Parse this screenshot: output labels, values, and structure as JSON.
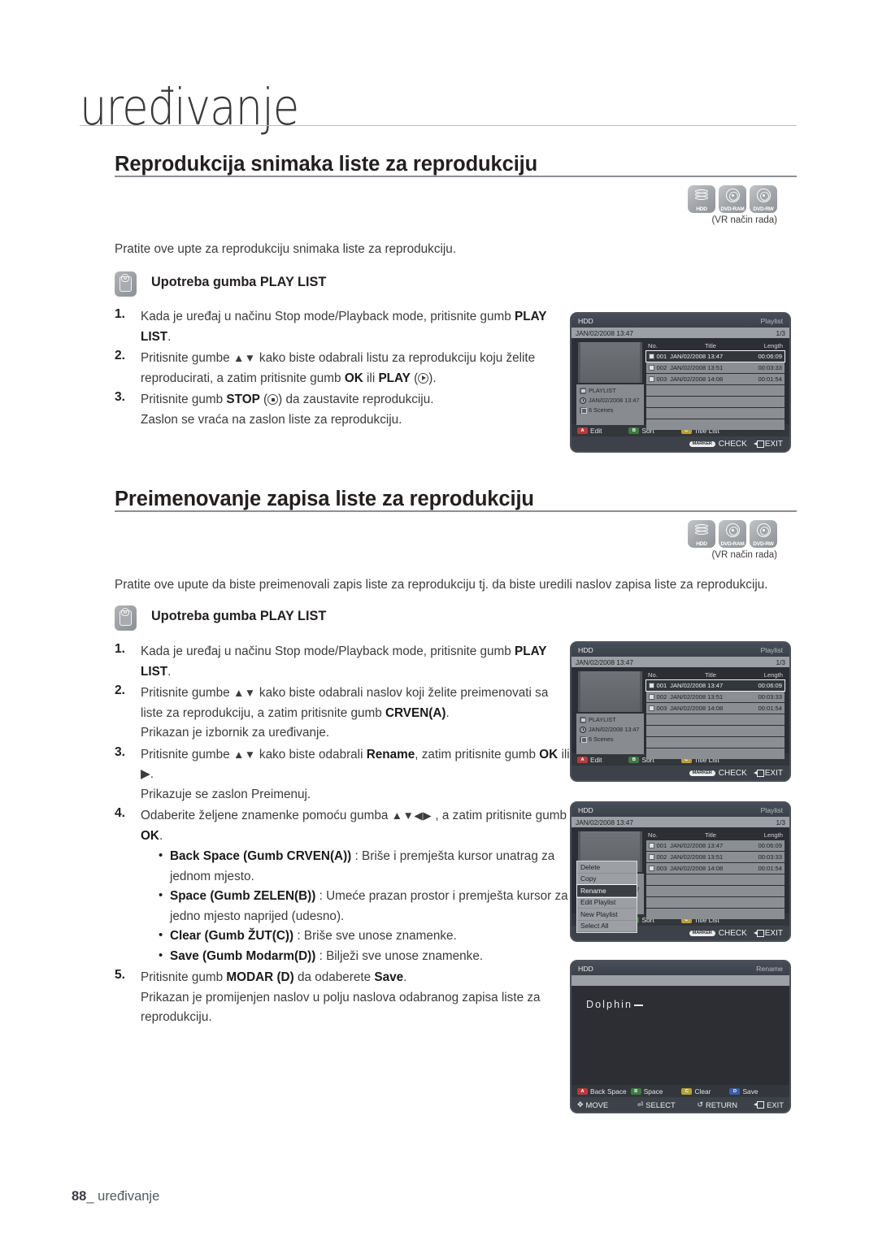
{
  "chapter": {
    "title": "uređivanje"
  },
  "footer": {
    "page": "88",
    "sep": "_",
    "label": "uređivanje"
  },
  "media": {
    "hdd_label": "HDD",
    "dvdram_label": "DVD-RAM",
    "dvdrw_label": "DVD-RW",
    "caption": "(VR način rada)"
  },
  "section1": {
    "heading": "Reprodukcija snimaka liste za reprodukciju",
    "intro": "Pratite ove upte za reprodukciju snimaka liste za reprodukciju.",
    "use_button_label": "Upotreba gumba PLAY LIST",
    "steps": [
      {
        "num": "1."
      },
      {
        "num": "2."
      },
      {
        "num": "3."
      }
    ],
    "step1_a": "Kada je uređaj u načinu Stop mode/Playback mode, pritisnite gumb ",
    "step1_b": "PLAY LIST",
    "step1_c": ".",
    "step2_a": "Pritisnite gumbe ",
    "step2_arrows": "▲▼",
    "step2_b": " kako biste odabrali listu za reprodukciju koju želite reproducirati, a zatim pritisnite gumb ",
    "step2_ok": "OK",
    "step2_ili": " ili ",
    "step2_play": "PLAY",
    "step2_end": ").",
    "step3_a": "Pritisnite gumb ",
    "step3_stop": "STOP",
    "step3_b": ") da zaustavite reprodukciju.",
    "step3_c": "Zaslon se vraća na zaslon liste za reprodukciju."
  },
  "section2": {
    "heading": "Preimenovanje zapisa liste za reprodukciju",
    "intro": "Pratite ove upute da biste preimenovali zapis liste za reprodukciju tj. da biste uredili naslov zapisa liste za reprodukciju.",
    "use_button_label": "Upotreba gumba PLAY LIST",
    "step1_a": "Kada je uređaj u načinu Stop mode/Playback mode, pritisnite gumb ",
    "step1_b": "PLAY LIST",
    "step1_c": ".",
    "step2_a": "Pritisnite gumbe ",
    "step2_arrows": "▲▼",
    "step2_b": " kako biste odabrali naslov koji želite preimenovati sa liste za reprodukciju, a zatim pritisnite gumb ",
    "step2_crven": "CRVEN(A)",
    "step2_dot": ".",
    "step2_note": "Prikazan je izbornik za uređivanje.",
    "step3_a": "Pritisnite gumbe ",
    "step3_arrows": "▲▼",
    "step3_b": " kako biste odabrali ",
    "step3_rename": "Rename",
    "step3_c": ", zatim pritisnite gumb ",
    "step3_ok": "OK",
    "step3_d": " ili ▶.",
    "step3_note": "Prikazuje se zaslon Preimenuj.",
    "step4_a": "Odaberite željene znamenke pomoću gumba ",
    "step4_arrows": "▲▼◀▶",
    "step4_b": " , a zatim pritisnite gumb ",
    "step4_ok": "OK",
    "step4_c": ".",
    "bullets": [
      {
        "bold": "Back Space (Gumb CRVEN(A))",
        "rest": " : Briše i premješta kursor unatrag za jednom mjesto."
      },
      {
        "bold": "Space (Gumb ZELEN(B))",
        "rest": " : Umeće prazan prostor i premješta kursor za jedno mjesto naprijed (udesno)."
      },
      {
        "bold": "Clear (Gumb ŽUT(C))",
        "rest": " : Briše sve unose znamenke."
      },
      {
        "bold": "Save (Gumb Modarm(D))",
        "rest": " : Bilježi sve unose znamenke."
      }
    ],
    "step5_a": "Pritisnite gumb ",
    "step5_modar": "MODAR (D)",
    "step5_b": " da odaberete ",
    "step5_save": "Save",
    "step5_c": ".",
    "step5_note": "Prikazan je promijenjen naslov u polju naslova odabranog zapisa liste za reprodukciju."
  },
  "osd_playlist": {
    "head_title": "HDD",
    "head_right": "Playlist",
    "sub_left": "JAN/02/2008 13:47",
    "sub_right": "1/3",
    "info": {
      "type": "PLAYLIST",
      "date": "JAN/02/2008 13:47",
      "scenes": "6 Scenes"
    },
    "columns": {
      "no": "No.",
      "title": "Title",
      "length": "Length"
    },
    "rows": [
      {
        "no": "001",
        "title": "JAN/02/2008 13:47",
        "length": "00:06:09",
        "selected": true
      },
      {
        "no": "002",
        "title": "JAN/02/2008 13:51",
        "length": "00:03:33",
        "selected": false
      },
      {
        "no": "003",
        "title": "JAN/02/2008 14:08",
        "length": "00:01:54",
        "selected": false
      }
    ],
    "empty_rows": 4,
    "bar_keys": [
      {
        "key": "A",
        "label": "Edit"
      },
      {
        "key": "B",
        "label": "Sort"
      },
      {
        "key": "C",
        "label": "Title List"
      }
    ],
    "marker_pill": "MARKER",
    "marker_label": "CHECK",
    "exit_label": "EXIT"
  },
  "osd_menu": {
    "items": [
      {
        "label": "Delete",
        "selected": false
      },
      {
        "label": "Copy",
        "selected": false
      },
      {
        "label": "Rename",
        "selected": true
      },
      {
        "label": "Edit Playlist",
        "selected": false
      },
      {
        "label": "New Playlist",
        "selected": false
      },
      {
        "label": "Select All",
        "selected": false
      }
    ]
  },
  "osd_rename": {
    "head_title": "HDD",
    "head_right": "Rename",
    "value": "Dolphin",
    "bar_keys": [
      {
        "key": "A",
        "label": "Back Space"
      },
      {
        "key": "B",
        "label": "Space"
      },
      {
        "key": "C",
        "label": "Clear"
      },
      {
        "key": "D",
        "label": "Save"
      }
    ],
    "nav": {
      "move": "MOVE",
      "select": "SELECT",
      "return": "RETURN",
      "exit": "EXIT"
    }
  }
}
